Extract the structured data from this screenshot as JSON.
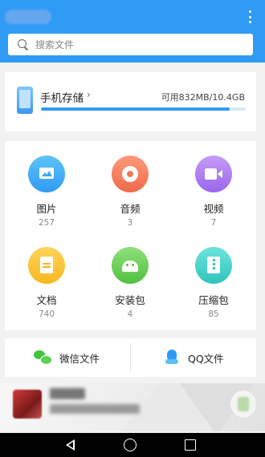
{
  "header": {
    "title": "",
    "menu_icon": "more-vertical-icon"
  },
  "search": {
    "placeholder": "搜索文件"
  },
  "storage": {
    "title": "手机存储",
    "chevron": "›",
    "free_text": "可用832MB/10.4GB",
    "used_fraction": 0.92
  },
  "categories": [
    {
      "label": "图片",
      "count": "257",
      "icon": "image-icon"
    },
    {
      "label": "音频",
      "count": "3",
      "icon": "audio-icon"
    },
    {
      "label": "视频",
      "count": "7",
      "icon": "video-icon"
    },
    {
      "label": "文档",
      "count": "740",
      "icon": "document-icon"
    },
    {
      "label": "安装包",
      "count": "4",
      "icon": "apk-icon"
    },
    {
      "label": "压缩包",
      "count": "85",
      "icon": "zip-icon"
    }
  ],
  "shortcuts": {
    "wechat": "微信文件",
    "qq": "QQ文件"
  },
  "colors": {
    "accent": "#2f9bf5"
  }
}
